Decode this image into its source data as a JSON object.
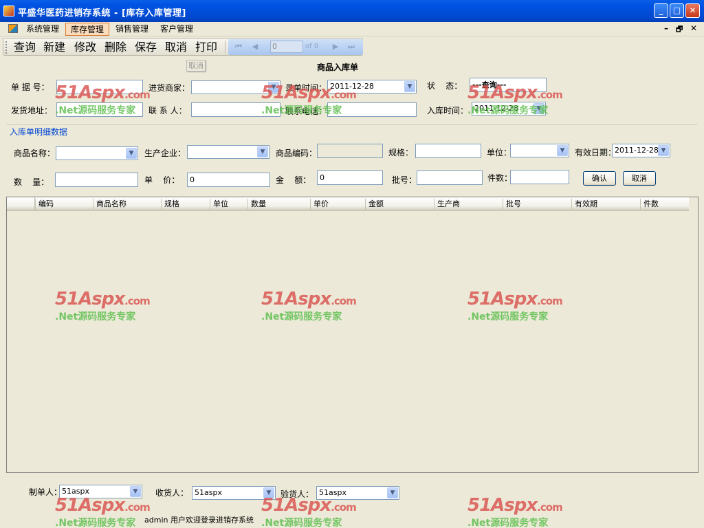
{
  "window": {
    "title": "平盛华医药进销存系统 - [库存入库管理]",
    "minimize": "_",
    "maximize": "□",
    "close": "✕"
  },
  "menu": {
    "items": [
      "系统管理",
      "库存管理",
      "销售管理",
      "客户管理"
    ],
    "active_index": 1,
    "mdi_controls": [
      "–",
      "🗗",
      "✕"
    ]
  },
  "toolbar": {
    "buttons": [
      "查询",
      "新建",
      "修改",
      "删除",
      "保存",
      "取消",
      "打印"
    ],
    "navigator": {
      "position": "0",
      "of_label": "of 0",
      "first": "⏮",
      "prev": "◀",
      "next": "▶",
      "last": "⏭"
    },
    "tooltip": "取消"
  },
  "form": {
    "title": "商品入库单",
    "fields": {
      "doc_no": {
        "label": "单 据 号：",
        "value": ""
      },
      "supplier": {
        "label": "进货商家：",
        "value": ""
      },
      "entry_time": {
        "label": "录单时间：",
        "value": "2011-12-28"
      },
      "status": {
        "label": "状    态：",
        "value": "---查询---"
      },
      "ship_address": {
        "label": "发货地址：",
        "value": ""
      },
      "contact": {
        "label": "联 系 人：",
        "value": ""
      },
      "phone": {
        "label": "联系电话：",
        "value": ""
      },
      "stock_in_time": {
        "label": "入库时间：",
        "value": "2011-12-28"
      }
    }
  },
  "detail": {
    "group_title": "入库单明细数据",
    "fields": {
      "product_name": {
        "label": "商品名称：",
        "value": ""
      },
      "manufacturer": {
        "label": "生产企业：",
        "value": ""
      },
      "product_code": {
        "label": "商品编码：",
        "value": ""
      },
      "spec": {
        "label": "规格：",
        "value": ""
      },
      "unit": {
        "label": "单位：",
        "value": ""
      },
      "expiry": {
        "label": "有效日期：",
        "value": "2011-12-28"
      },
      "quantity": {
        "label": "数    量：",
        "value": ""
      },
      "unit_price": {
        "label": "单    价：",
        "value": "0"
      },
      "amount": {
        "label": "金    额：",
        "value": "0"
      },
      "batch_no": {
        "label": "批号：",
        "value": ""
      },
      "pieces": {
        "label": "件数：",
        "value": ""
      }
    },
    "confirm_button": "确认",
    "cancel_button": "取消"
  },
  "grid": {
    "columns": [
      "编码",
      "商品名称",
      "规格",
      "单位",
      "数量",
      "单价",
      "金额",
      "生产商",
      "批号",
      "有效期",
      "件数"
    ]
  },
  "footer": {
    "creator": {
      "label": "制单人：",
      "value": "51aspx"
    },
    "receiver": {
      "label": "收货人：",
      "value": "51aspx"
    },
    "inspector": {
      "label": "验货人：",
      "value": "51aspx"
    }
  },
  "status": {
    "text": "admin 用户欢迎登录进销存系统"
  },
  "watermark": {
    "brand": "51Aspx",
    "domain": ".com",
    "slogan": ".Net源码服务专家"
  }
}
